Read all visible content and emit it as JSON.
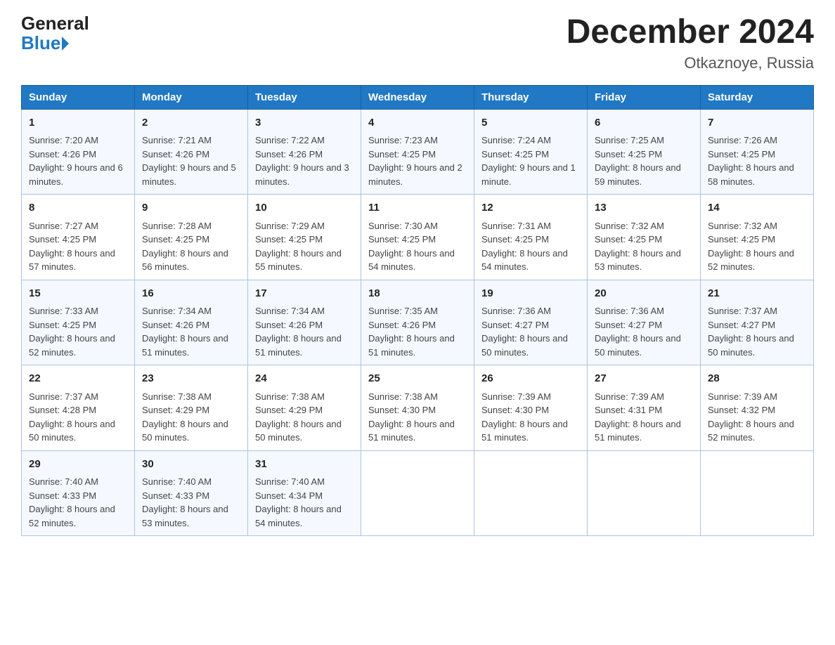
{
  "header": {
    "logo_general": "General",
    "logo_blue": "Blue",
    "title": "December 2024",
    "subtitle": "Otkaznoye, Russia"
  },
  "days_of_week": [
    "Sunday",
    "Monday",
    "Tuesday",
    "Wednesday",
    "Thursday",
    "Friday",
    "Saturday"
  ],
  "weeks": [
    [
      {
        "day": "1",
        "sunrise": "7:20 AM",
        "sunset": "4:26 PM",
        "daylight": "9 hours and 6 minutes."
      },
      {
        "day": "2",
        "sunrise": "7:21 AM",
        "sunset": "4:26 PM",
        "daylight": "9 hours and 5 minutes."
      },
      {
        "day": "3",
        "sunrise": "7:22 AM",
        "sunset": "4:26 PM",
        "daylight": "9 hours and 3 minutes."
      },
      {
        "day": "4",
        "sunrise": "7:23 AM",
        "sunset": "4:25 PM",
        "daylight": "9 hours and 2 minutes."
      },
      {
        "day": "5",
        "sunrise": "7:24 AM",
        "sunset": "4:25 PM",
        "daylight": "9 hours and 1 minute."
      },
      {
        "day": "6",
        "sunrise": "7:25 AM",
        "sunset": "4:25 PM",
        "daylight": "8 hours and 59 minutes."
      },
      {
        "day": "7",
        "sunrise": "7:26 AM",
        "sunset": "4:25 PM",
        "daylight": "8 hours and 58 minutes."
      }
    ],
    [
      {
        "day": "8",
        "sunrise": "7:27 AM",
        "sunset": "4:25 PM",
        "daylight": "8 hours and 57 minutes."
      },
      {
        "day": "9",
        "sunrise": "7:28 AM",
        "sunset": "4:25 PM",
        "daylight": "8 hours and 56 minutes."
      },
      {
        "day": "10",
        "sunrise": "7:29 AM",
        "sunset": "4:25 PM",
        "daylight": "8 hours and 55 minutes."
      },
      {
        "day": "11",
        "sunrise": "7:30 AM",
        "sunset": "4:25 PM",
        "daylight": "8 hours and 54 minutes."
      },
      {
        "day": "12",
        "sunrise": "7:31 AM",
        "sunset": "4:25 PM",
        "daylight": "8 hours and 54 minutes."
      },
      {
        "day": "13",
        "sunrise": "7:32 AM",
        "sunset": "4:25 PM",
        "daylight": "8 hours and 53 minutes."
      },
      {
        "day": "14",
        "sunrise": "7:32 AM",
        "sunset": "4:25 PM",
        "daylight": "8 hours and 52 minutes."
      }
    ],
    [
      {
        "day": "15",
        "sunrise": "7:33 AM",
        "sunset": "4:25 PM",
        "daylight": "8 hours and 52 minutes."
      },
      {
        "day": "16",
        "sunrise": "7:34 AM",
        "sunset": "4:26 PM",
        "daylight": "8 hours and 51 minutes."
      },
      {
        "day": "17",
        "sunrise": "7:34 AM",
        "sunset": "4:26 PM",
        "daylight": "8 hours and 51 minutes."
      },
      {
        "day": "18",
        "sunrise": "7:35 AM",
        "sunset": "4:26 PM",
        "daylight": "8 hours and 51 minutes."
      },
      {
        "day": "19",
        "sunrise": "7:36 AM",
        "sunset": "4:27 PM",
        "daylight": "8 hours and 50 minutes."
      },
      {
        "day": "20",
        "sunrise": "7:36 AM",
        "sunset": "4:27 PM",
        "daylight": "8 hours and 50 minutes."
      },
      {
        "day": "21",
        "sunrise": "7:37 AM",
        "sunset": "4:27 PM",
        "daylight": "8 hours and 50 minutes."
      }
    ],
    [
      {
        "day": "22",
        "sunrise": "7:37 AM",
        "sunset": "4:28 PM",
        "daylight": "8 hours and 50 minutes."
      },
      {
        "day": "23",
        "sunrise": "7:38 AM",
        "sunset": "4:29 PM",
        "daylight": "8 hours and 50 minutes."
      },
      {
        "day": "24",
        "sunrise": "7:38 AM",
        "sunset": "4:29 PM",
        "daylight": "8 hours and 50 minutes."
      },
      {
        "day": "25",
        "sunrise": "7:38 AM",
        "sunset": "4:30 PM",
        "daylight": "8 hours and 51 minutes."
      },
      {
        "day": "26",
        "sunrise": "7:39 AM",
        "sunset": "4:30 PM",
        "daylight": "8 hours and 51 minutes."
      },
      {
        "day": "27",
        "sunrise": "7:39 AM",
        "sunset": "4:31 PM",
        "daylight": "8 hours and 51 minutes."
      },
      {
        "day": "28",
        "sunrise": "7:39 AM",
        "sunset": "4:32 PM",
        "daylight": "8 hours and 52 minutes."
      }
    ],
    [
      {
        "day": "29",
        "sunrise": "7:40 AM",
        "sunset": "4:33 PM",
        "daylight": "8 hours and 52 minutes."
      },
      {
        "day": "30",
        "sunrise": "7:40 AM",
        "sunset": "4:33 PM",
        "daylight": "8 hours and 53 minutes."
      },
      {
        "day": "31",
        "sunrise": "7:40 AM",
        "sunset": "4:34 PM",
        "daylight": "8 hours and 54 minutes."
      },
      null,
      null,
      null,
      null
    ]
  ],
  "labels": {
    "sunrise": "Sunrise:",
    "sunset": "Sunset:",
    "daylight": "Daylight:"
  }
}
